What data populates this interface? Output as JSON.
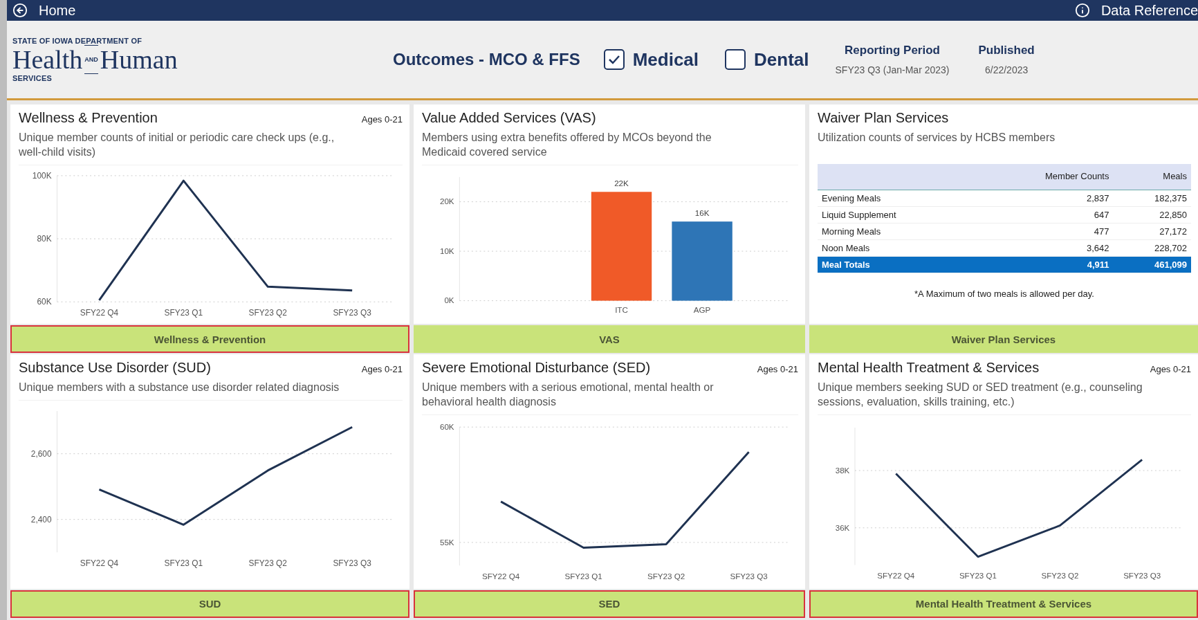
{
  "topbar": {
    "home": "Home",
    "reference": "Data Reference"
  },
  "logo": {
    "line1": "STATE OF IOWA DEPARTMENT OF",
    "word1": "Health",
    "joiner": "AND",
    "word2": "Human",
    "line3": "SERVICES"
  },
  "header": {
    "title": "Outcomes -  MCO & FFS",
    "filters": [
      {
        "label": "Medical",
        "checked": true
      },
      {
        "label": "Dental",
        "checked": false
      }
    ],
    "reporting_period": {
      "label": "Reporting Period",
      "value": "SFY23 Q3 (Jan-Mar 2023)"
    },
    "published": {
      "label": "Published",
      "value": "6/22/2023"
    }
  },
  "cards": [
    {
      "title": "Wellness & Prevention",
      "badge": "Ages 0-21",
      "description": "Unique member counts of initial or periodic care check ups (e.g., well-child visits)",
      "button": {
        "label": "Wellness & Prevention",
        "outlined": true
      },
      "chart_data": {
        "type": "line",
        "categories": [
          "SFY22 Q4",
          "SFY23 Q1",
          "SFY23 Q2",
          "SFY23 Q3"
        ],
        "series": [
          {
            "color": "#1f3251",
            "values": [
              60500,
              98400,
              64800,
              63600
            ]
          }
        ],
        "ylim": [
          60000,
          100000
        ],
        "yticks": [
          {
            "value": 60000,
            "label": "60K"
          },
          {
            "value": 80000,
            "label": "80K"
          },
          {
            "value": 100000,
            "label": "100K"
          }
        ]
      }
    },
    {
      "title": "Value Added Services (VAS)",
      "description": "Members using extra benefits offered by MCOs beyond the Medicaid covered service",
      "button": {
        "label": "VAS",
        "outlined": false
      },
      "chart_data": {
        "type": "bar",
        "categories": [
          "ITC",
          "AGP"
        ],
        "series": [
          {
            "color": "#f05a28",
            "values": [
              22000,
              null
            ]
          },
          {
            "color": "#2e75b6",
            "values": [
              null,
              16000
            ]
          }
        ],
        "value_labels": [
          "22K",
          "16K"
        ],
        "ylim": [
          0,
          25000
        ],
        "yticks": [
          {
            "value": 0,
            "label": "0K"
          },
          {
            "value": 10000,
            "label": "10K"
          },
          {
            "value": 20000,
            "label": "20K"
          }
        ]
      }
    },
    {
      "title": "Waiver Plan Services",
      "description": "Utilization counts of services by HCBS members",
      "button": {
        "label": "Waiver Plan Services",
        "outlined": false
      },
      "table": {
        "columns": [
          "Member Counts",
          "Meals"
        ],
        "rows": [
          {
            "kind": "data",
            "label": "Evening Meals",
            "values": [
              "2,837",
              "182,375"
            ]
          },
          {
            "kind": "data",
            "label": "Liquid Supplement",
            "values": [
              "647",
              "22,850"
            ]
          },
          {
            "kind": "data",
            "label": "Morning Meals",
            "values": [
              "477",
              "27,172"
            ]
          },
          {
            "kind": "data",
            "label": "Noon Meals",
            "values": [
              "3,642",
              "228,702"
            ]
          },
          {
            "kind": "total",
            "label": "Meal Totals",
            "values": [
              "4,911",
              "461,099"
            ]
          }
        ],
        "footnote": "*A Maximum of two meals is allowed per day."
      }
    },
    {
      "title": "Substance Use Disorder (SUD)",
      "badge": "Ages 0-21",
      "description": "Unique members with a substance use disorder related diagnosis",
      "button": {
        "label": "SUD",
        "outlined": true
      },
      "chart_data": {
        "type": "line",
        "categories": [
          "SFY22 Q4",
          "SFY23 Q1",
          "SFY23 Q2",
          "SFY23 Q3"
        ],
        "series": [
          {
            "color": "#1f3251",
            "values": [
              2491,
              2384,
              2549,
              2681
            ]
          }
        ],
        "ylim": [
          2300,
          2730
        ],
        "yticks": [
          {
            "value": 2400,
            "label": "2,400"
          },
          {
            "value": 2600,
            "label": "2,600"
          }
        ]
      }
    },
    {
      "title": "Severe Emotional Disturbance (SED)",
      "badge": "Ages 0-21",
      "description": "Unique members with a serious emotional, mental health or behavioral health diagnosis",
      "button": {
        "label": "SED",
        "outlined": true
      },
      "chart_data": {
        "type": "line",
        "categories": [
          "SFY22 Q4",
          "SFY23 Q1",
          "SFY23 Q2",
          "SFY23 Q3"
        ],
        "series": [
          {
            "color": "#1f3251",
            "values": [
              56770,
              54770,
              54920,
              58920
            ]
          }
        ],
        "ylim": [
          54000,
          60000
        ],
        "yticks": [
          {
            "value": 55000,
            "label": "55K"
          },
          {
            "value": 60000,
            "label": "60K"
          }
        ]
      }
    },
    {
      "title": "Mental Health Treatment & Services",
      "badge": "Ages 0-21",
      "description": "Unique members seeking SUD or SED treatment (e.g., counseling sessions, evaluation, skills training, etc.)",
      "button": {
        "label": "Mental Health Treatment & Services",
        "outlined": true
      },
      "chart_data": {
        "type": "line",
        "categories": [
          "SFY22 Q4",
          "SFY23 Q1",
          "SFY23 Q2",
          "SFY23 Q3"
        ],
        "series": [
          {
            "color": "#1f3251",
            "values": [
              37890,
              34990,
              36080,
              38380
            ]
          }
        ],
        "ylim": [
          34700,
          39500
        ],
        "yticks": [
          {
            "value": 36000,
            "label": "36K"
          },
          {
            "value": 38000,
            "label": "38K"
          }
        ]
      }
    }
  ]
}
